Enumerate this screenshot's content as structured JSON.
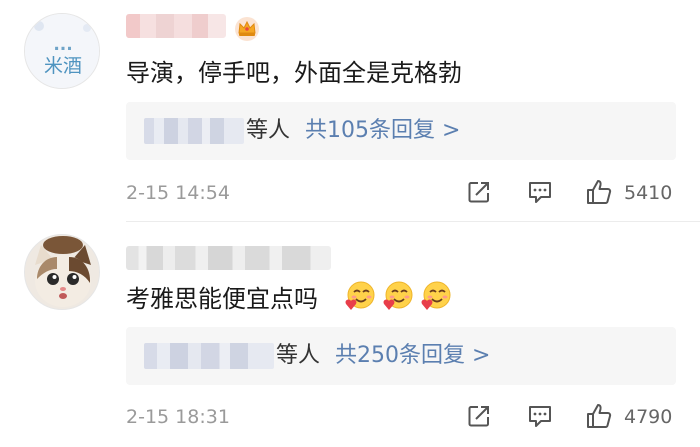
{
  "comments": [
    {
      "text": "导演，停手吧，外面全是克格勃",
      "avatar_text": [
        "...",
        "米酒"
      ],
      "reply_suffix": "等人",
      "reply_link": "共105条回复 >",
      "timestamp": "2-15 14:54",
      "likes": "5410",
      "badge_icon": "crown-icon"
    },
    {
      "text": "考雅思能便宜点吗",
      "emoji_icons": [
        "smiling-face-with-heart-icon",
        "smiling-face-with-heart-icon",
        "smiling-face-with-heart-icon"
      ],
      "reply_suffix": "等人",
      "reply_link": "共250条回复 >",
      "timestamp": "2-15 18:31",
      "likes": "4790"
    }
  ],
  "actions": {
    "share_icon": "share-icon",
    "reply_icon": "comment-icon",
    "like_icon": "thumbs-up-icon"
  },
  "colors": {
    "link": "#5b7fb0",
    "meta": "#9a9a9a",
    "reply_box_bg": "#f6f6f6"
  }
}
